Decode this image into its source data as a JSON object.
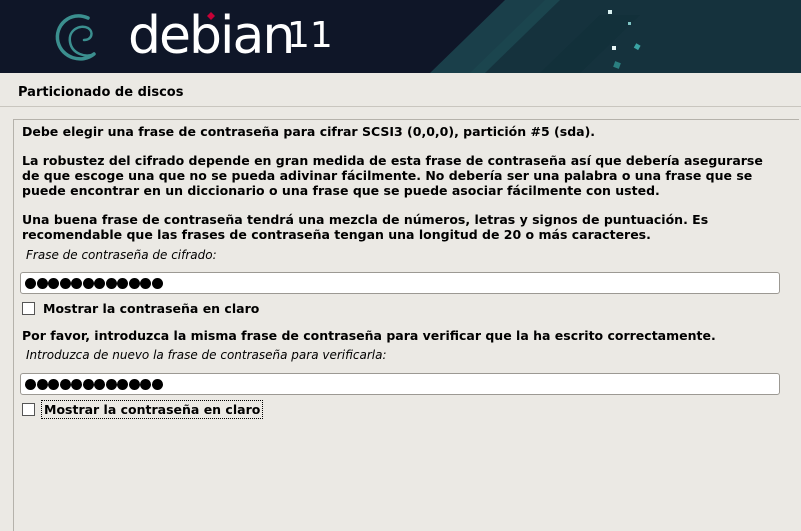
{
  "header": {
    "logo_text": "debian",
    "version": "11",
    "logo_icon": "debian-swirl-icon"
  },
  "page_title": "Particionado de discos",
  "content": {
    "intro": "Debe elegir una frase de contraseña para cifrar SCSI3 (0,0,0), partición #5 (sda).",
    "robustness": "La robustez del cifrado depende en gran medida de esta frase de contraseña así que debería asegurarse de que escoge una que no se pueda adivinar fácilmente. No debería ser una palabra o una frase que se puede encontrar en un diccionario o una frase que se puede asociar fácilmente con usted.",
    "good_phrase": "Una buena frase de contraseña tendrá una mezcla de números, letras y signos de puntuación. Es recomendable que las frases de contraseña tengan una longitud de 20 o más caracteres.",
    "field1_label": "Frase de contraseña de cifrado:",
    "field1_masked_length": 12,
    "show1_label": "Mostrar la contraseña en claro",
    "verify_text": "Por favor, introduzca la misma frase de contraseña para verificar que la ha escrito correctamente.",
    "field2_label": "Introduzca de nuevo la frase de contraseña para verificarla:",
    "field2_masked_length": 12,
    "show2_label": "Mostrar la contraseña en claro"
  },
  "colors": {
    "banner_bg": "#0f1628",
    "page_bg": "#ebe9e4",
    "accent_red": "#c70036",
    "teal": "#1f6b6e"
  }
}
